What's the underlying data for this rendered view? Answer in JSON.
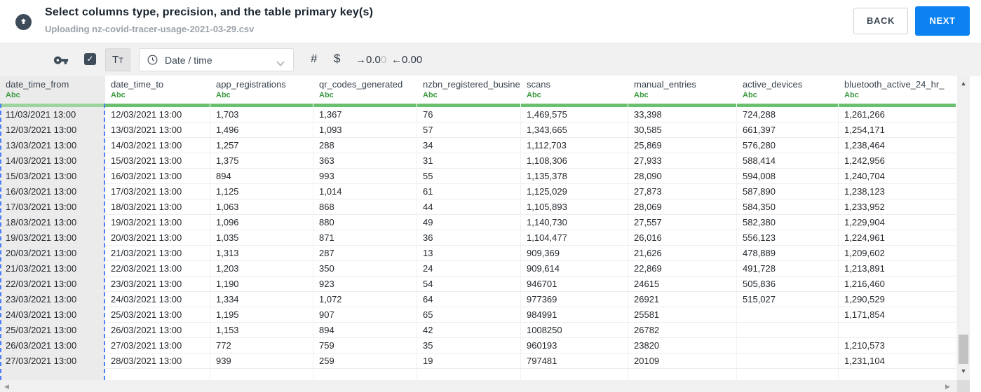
{
  "header": {
    "title": "Select columns type, precision, and the table primary key(s)",
    "subtitle": "Uploading nz-covid-tracer-usage-2021-03-29.csv",
    "back_label": "BACK",
    "next_label": "NEXT"
  },
  "toolbar": {
    "checkbox_checked": true,
    "check_glyph": "✓",
    "text_type_label": "Tt",
    "type_dropdown_value": "Date / time",
    "hash_label": "#",
    "dollar_label": "$",
    "decimal_right_label": "→0.0",
    "decimal_right_faded": "0",
    "decimal_left_label": "←0.00",
    "icons": [
      "key-icon",
      "checkbox",
      "text-type-button",
      "clock-icon",
      "chevron-down-icon",
      "hash-icon",
      "dollar-icon",
      "decimal-right-icon",
      "decimal-left-icon"
    ]
  },
  "scrollbar": {
    "up_glyph": "▲",
    "down_glyph": "▼",
    "left_glyph": "◀",
    "right_glyph": "▶"
  },
  "colors": {
    "accent_blue": "#0c82f2",
    "selection_dash_blue": "#4b80f6",
    "column_bar_green": "#6cc06d",
    "selected_column_bar_green": "#9dd49e",
    "type_label_green": "#3d9a42",
    "icon_dark": "#3e4c59"
  },
  "table": {
    "columns": [
      {
        "name": "date_time_from",
        "type": "Abc",
        "selected": true
      },
      {
        "name": "date_time_to",
        "type": "Abc",
        "selected": false
      },
      {
        "name": "app_registrations",
        "type": "Abc",
        "selected": false
      },
      {
        "name": "qr_codes_generated",
        "type": "Abc",
        "selected": false
      },
      {
        "name": "nzbn_registered_busine",
        "type": "Abc",
        "selected": false
      },
      {
        "name": "scans",
        "type": "Abc",
        "selected": false
      },
      {
        "name": "manual_entries",
        "type": "Abc",
        "selected": false
      },
      {
        "name": "active_devices",
        "type": "Abc",
        "selected": false
      },
      {
        "name": "bluetooth_active_24_hr_",
        "type": "Abc",
        "selected": false
      }
    ],
    "rows": [
      [
        "11/03/2021 13:00",
        "12/03/2021 13:00",
        "1,703",
        "1,367",
        "76",
        "1,469,575",
        "33,398",
        "724,288",
        "1,261,266"
      ],
      [
        "12/03/2021 13:00",
        "13/03/2021 13:00",
        "1,496",
        "1,093",
        "57",
        "1,343,665",
        "30,585",
        "661,397",
        "1,254,171"
      ],
      [
        "13/03/2021 13:00",
        "14/03/2021 13:00",
        "1,257",
        "288",
        "34",
        "1,112,703",
        "25,869",
        "576,280",
        "1,238,464"
      ],
      [
        "14/03/2021 13:00",
        "15/03/2021 13:00",
        "1,375",
        "363",
        "31",
        "1,108,306",
        "27,933",
        "588,414",
        "1,242,956"
      ],
      [
        "15/03/2021 13:00",
        "16/03/2021 13:00",
        "894",
        "993",
        "55",
        "1,135,378",
        "28,090",
        "594,008",
        "1,240,704"
      ],
      [
        "16/03/2021 13:00",
        "17/03/2021 13:00",
        "1,125",
        "1,014",
        "61",
        "1,125,029",
        "27,873",
        "587,890",
        "1,238,123"
      ],
      [
        "17/03/2021 13:00",
        "18/03/2021 13:00",
        "1,063",
        "868",
        "44",
        "1,105,893",
        "28,069",
        "584,350",
        "1,233,952"
      ],
      [
        "18/03/2021 13:00",
        "19/03/2021 13:00",
        "1,096",
        "880",
        "49",
        "1,140,730",
        "27,557",
        "582,380",
        "1,229,904"
      ],
      [
        "19/03/2021 13:00",
        "20/03/2021 13:00",
        "1,035",
        "871",
        "36",
        "1,104,477",
        "26,016",
        "556,123",
        "1,224,961"
      ],
      [
        "20/03/2021 13:00",
        "21/03/2021 13:00",
        "1,313",
        "287",
        "13",
        "909,369",
        "21,626",
        "478,889",
        "1,209,602"
      ],
      [
        "21/03/2021 13:00",
        "22/03/2021 13:00",
        "1,203",
        "350",
        "24",
        "909,614",
        "22,869",
        "491,728",
        "1,213,891"
      ],
      [
        "22/03/2021 13:00",
        "23/03/2021 13:00",
        "1,190",
        "923",
        "54",
        "946701",
        "24615",
        "505,836",
        "1,216,460"
      ],
      [
        "23/03/2021 13:00",
        "24/03/2021 13:00",
        "1,334",
        "1,072",
        "64",
        "977369",
        "26921",
        "515,027",
        "1,290,529"
      ],
      [
        "24/03/2021 13:00",
        "25/03/2021 13:00",
        "1,195",
        "907",
        "65",
        "984991",
        "25581",
        "",
        "1,171,854"
      ],
      [
        "25/03/2021 13:00",
        "26/03/2021 13:00",
        "1,153",
        "894",
        "42",
        "1008250",
        "26782",
        "",
        ""
      ],
      [
        "26/03/2021 13:00",
        "27/03/2021 13:00",
        "772",
        "759",
        "35",
        "960193",
        "23820",
        "",
        "1,210,573"
      ],
      [
        "27/03/2021 13:00",
        "28/03/2021 13:00",
        "939",
        "259",
        "19",
        "797481",
        "20109",
        "",
        "1,231,104"
      ]
    ]
  }
}
